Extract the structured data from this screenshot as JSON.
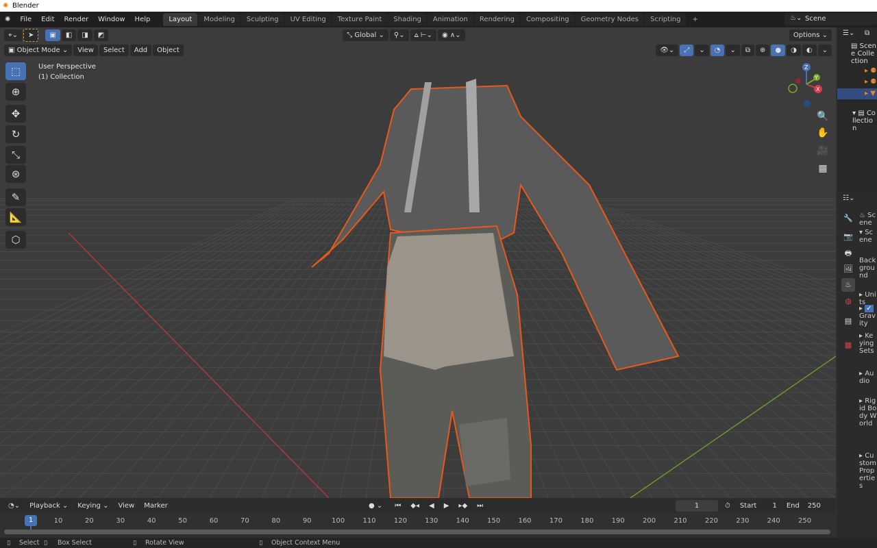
{
  "window": {
    "title": "Blender"
  },
  "menu": [
    "File",
    "Edit",
    "Render",
    "Window",
    "Help"
  ],
  "workspaces": [
    "Layout",
    "Modeling",
    "Sculpting",
    "UV Editing",
    "Texture Paint",
    "Shading",
    "Animation",
    "Rendering",
    "Compositing",
    "Geometry Nodes",
    "Scripting"
  ],
  "add_workspace": "+",
  "scene_name": "Scene",
  "viewport": {
    "transform_orientation": "Global",
    "options": "Options",
    "mode": "Object Mode",
    "menus": [
      "View",
      "Select",
      "Add",
      "Object"
    ],
    "overlay_line1": "User Perspective",
    "overlay_line2": "(1) Collection",
    "gizmo": {
      "x": "X",
      "y": "Y",
      "z": "Z"
    }
  },
  "outliner": {
    "items": [
      "Scene Collection",
      "Collection"
    ]
  },
  "properties": {
    "title": "Scene",
    "section": "Scene",
    "background": "Background",
    "panels": [
      "Units",
      "Gravity",
      "Keying Sets",
      "Audio",
      "Rigid Body World",
      "Custom Properties"
    ],
    "gravity_checked": true
  },
  "timeline": {
    "menus": [
      "Playback",
      "Keying",
      "View",
      "Marker"
    ],
    "current_frame": "1",
    "start_label": "Start",
    "start": "1",
    "end_label": "End",
    "end": "250",
    "ticks": [
      "10",
      "20",
      "30",
      "40",
      "50",
      "60",
      "70",
      "80",
      "90",
      "100",
      "110",
      "120",
      "130",
      "140",
      "150",
      "160",
      "170",
      "180",
      "190",
      "200",
      "210",
      "220",
      "230",
      "240",
      "250"
    ]
  },
  "status": {
    "select": "Select",
    "box_select": "Box Select",
    "rotate": "Rotate View",
    "context": "Object Context Menu"
  },
  "colors": {
    "accent": "#4772b3",
    "selection": "#e8591a",
    "x_axis": "#b03838",
    "y_axis": "#6a9a2a"
  }
}
